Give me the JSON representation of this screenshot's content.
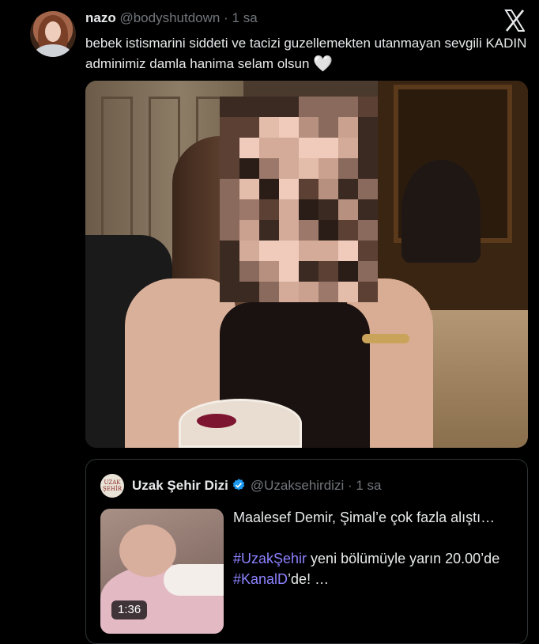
{
  "tweet": {
    "author_name": "nazo",
    "author_handle": "@bodyshutdown",
    "separator": "·",
    "time": "1 sa",
    "text": "bebek istismarini siddeti ve tacizi guzellemekten utanmayan sevgili KADIN adminimiz damla hanima selam olsun",
    "emoji": "🤍"
  },
  "logo": {
    "icon": "x-logo-icon"
  },
  "quote": {
    "avatar_text": "UZAK ŞEHİR",
    "author_name": "Uzak Şehir Dizi",
    "author_handle": "@Uzaksehirdizi",
    "separator": "·",
    "time": "1 sa",
    "video_duration": "1:36",
    "line1": "Maalesef Demir, Şimal’e çok fazla alıştı…",
    "hashtag1": "#UzakŞehir",
    "line2_part1": " yeni bölümüyle yarın 20.00’de ",
    "hashtag2": "#KanalD",
    "line2_part2": "’de! …"
  },
  "colors": {
    "background": "#000000",
    "text": "#e7e9ea",
    "muted": "#71767b",
    "hashtag": "#8c82ff",
    "verified": "#1d9bf0"
  }
}
